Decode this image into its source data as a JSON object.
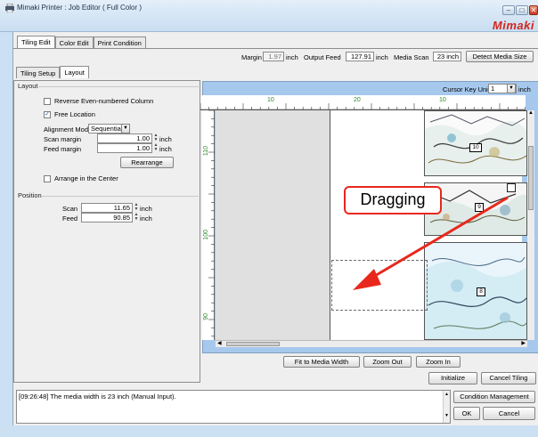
{
  "window": {
    "title": "Mimaki Printer : Job Editor ( Full Color )",
    "brand": "Mimaki",
    "min_glyph": "–",
    "max_glyph": "□",
    "close_glyph": "✕"
  },
  "main_tabs": [
    "Tiling Edit",
    "Color Edit",
    "Print Condition"
  ],
  "header": {
    "margin_label": "Margin",
    "margin_value": "1.97",
    "margin_unit": "inch",
    "output_feed_label": "Output Feed",
    "output_feed_value": "127.91",
    "output_feed_unit": "inch",
    "media_scan_label": "Media Scan",
    "media_scan_value": "23 inch",
    "detect_button": "Detect Media Size"
  },
  "sub_tabs": [
    "Tiling Setup",
    "Layout"
  ],
  "layout_group": {
    "title": "Layout",
    "reverse_label": "Reverse Even-numbered Column",
    "reverse_checked": false,
    "free_location_label": "Free Location",
    "free_location_checked": true,
    "alignment_label": "Alignment Mode",
    "alignment_value": "Sequential",
    "scan_margin_label": "Scan margin",
    "scan_margin_value": "1.00",
    "feed_margin_label": "Feed margin",
    "feed_margin_value": "1.00",
    "unit": "inch",
    "rearrange_button": "Rearrange",
    "center_label": "Arrange in the Center",
    "center_checked": false
  },
  "position_group": {
    "title": "Position",
    "scan_label": "Scan",
    "scan_value": "11.65",
    "feed_label": "Feed",
    "feed_value": "90.85",
    "unit": "inch"
  },
  "canvas": {
    "cursor_key_unit_label": "Cursor Key Unit",
    "cursor_key_unit_value": "1",
    "cursor_unit": "inch",
    "ruler_h_labels": [
      "10",
      "20",
      "10"
    ],
    "ruler_v_labels": [
      "110",
      "100",
      "90"
    ],
    "tile_numbers": [
      "10",
      "9",
      "8"
    ],
    "callout_text": "Dragging"
  },
  "view_buttons": [
    "Fit to Media Width",
    "Zoom Out",
    "Zoom In"
  ],
  "action_buttons": {
    "initialize": "Initialize",
    "cancel_tiling": "Cancel Tiling",
    "condition_management": "Condition Management",
    "ok": "OK",
    "cancel": "Cancel"
  },
  "log": {
    "message": "[09:26:48] The media width is 23 inch (Manual Input)."
  },
  "colors": {
    "accent_red": "#e8281c",
    "canvas_blue": "#a6c8ed"
  }
}
